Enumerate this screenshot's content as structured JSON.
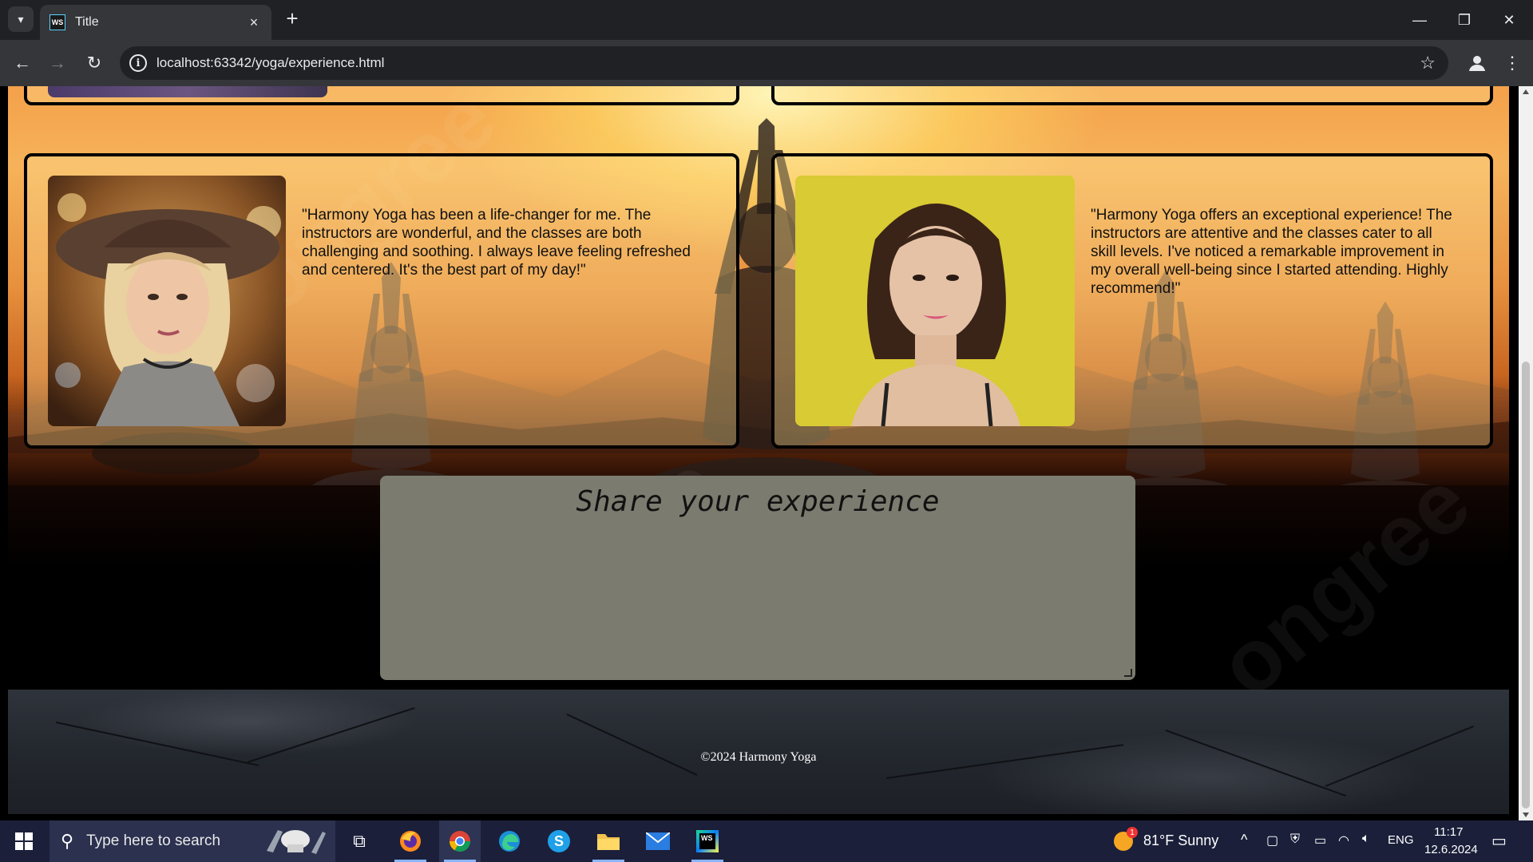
{
  "browser": {
    "tab_title": "Title",
    "favicon_text": "WS",
    "url": "localhost:63342/yoga/experience.html"
  },
  "page": {
    "testimonials": [
      {
        "quote": "\"Harmony Yoga has been a life-changer for me. The instructors are wonderful, and the classes are both challenging and soothing. I always leave feeling refreshed and centered. It's the best part of my day!\""
      },
      {
        "quote": "\"Harmony Yoga offers an exceptional experience! The instructors are attentive and the classes cater to all skill levels. I've noticed a remarkable improvement in my overall well-being since I started attending. Highly recommend!\""
      }
    ],
    "share_heading": "Share your experience",
    "footer_text": "©2024 Harmony Yoga",
    "watermark_text": "ongree"
  },
  "taskbar": {
    "search_placeholder": "Type here to search",
    "weather": "81°F  Sunny",
    "weather_badge": "1",
    "language": "ENG",
    "time": "11:17",
    "date": "12.6.2024"
  }
}
